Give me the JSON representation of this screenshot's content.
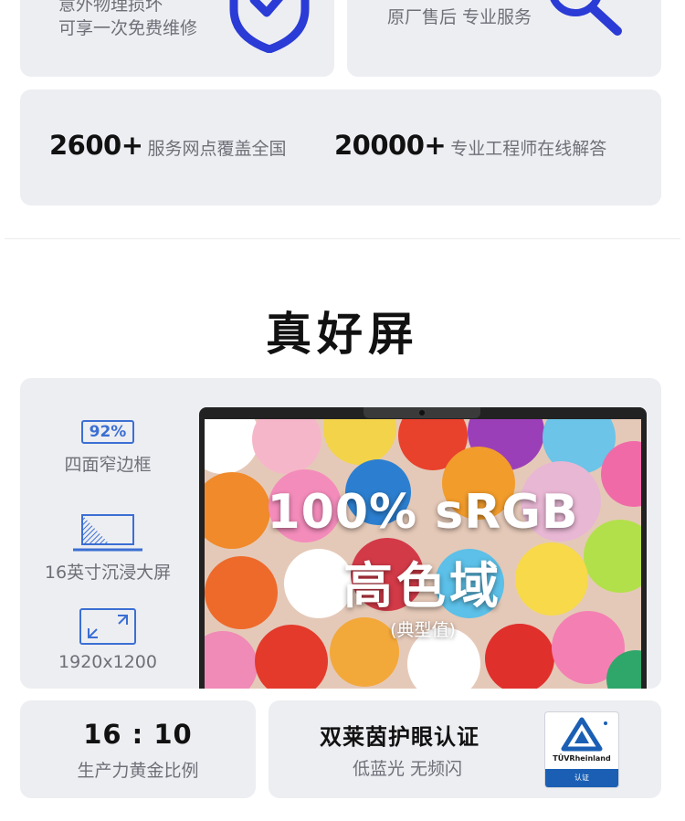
{
  "top_cards": {
    "left_lines": [
      "意外物理损坏",
      "可享一次免费维修"
    ],
    "right_line": "原厂售后 专业服务"
  },
  "stats": [
    {
      "number": "2600+",
      "label": "服务网点覆盖全国"
    },
    {
      "number": "20000+",
      "label": "专业工程师在线解答"
    }
  ],
  "section_title": "真好屏",
  "display_features": [
    {
      "badge": "92%",
      "label": "四面窄边框",
      "icon": "narrow-bezel-icon"
    },
    {
      "label": "16英寸沉浸大屏",
      "icon": "immersive-screen-icon"
    },
    {
      "label": "1920x1200",
      "icon": "resolution-icon"
    }
  ],
  "screen": {
    "headline": "100% sRGB",
    "subline": "高色域",
    "note": "(典型值)"
  },
  "ratio": {
    "value": "16 : 10",
    "label": "生产力黄金比例"
  },
  "certification": {
    "title": "双莱茵护眼认证",
    "subtitle": "低蓝光 无频闪",
    "badge_brand": "TÜVRheinland",
    "badge_band": "认证"
  },
  "colors": {
    "accent": "#3b6fd3",
    "card_bg": "#edeef2",
    "icon_stroke": "#2a3bd6"
  }
}
